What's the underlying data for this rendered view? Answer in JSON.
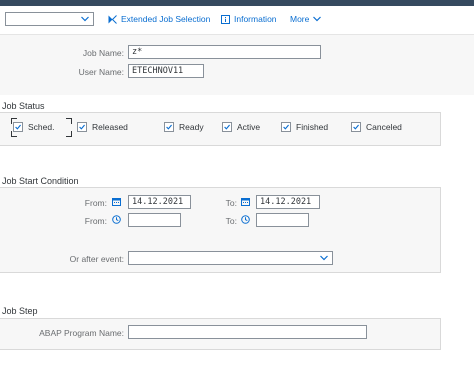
{
  "toolbar": {
    "variant_value": "",
    "extended_label": "Extended Job Selection",
    "information_label": "Information",
    "more_label": "More"
  },
  "job": {
    "name_label": "Job Name:",
    "name_value": "z*",
    "user_label": "User Name:",
    "user_value": "ETECHNOV11"
  },
  "status": {
    "title": "Job Status",
    "items": [
      {
        "label": "Sched.",
        "checked": true
      },
      {
        "label": "Released",
        "checked": true
      },
      {
        "label": "Ready",
        "checked": true
      },
      {
        "label": "Active",
        "checked": true
      },
      {
        "label": "Finished",
        "checked": true
      },
      {
        "label": "Canceled",
        "checked": true
      }
    ]
  },
  "start": {
    "title": "Job Start Condition",
    "from_label": "From:",
    "to_label": "To:",
    "from_date": "14.12.2021",
    "to_date": "14.12.2021",
    "from_time": "",
    "to_time": "",
    "event_label": "Or after event:",
    "event_value": ""
  },
  "step": {
    "title": "Job Step",
    "program_label": "ABAP Program Name:",
    "program_value": ""
  },
  "colors": {
    "accent": "#0a6ed1",
    "shell": "#354a5f",
    "border": "#89919a"
  }
}
